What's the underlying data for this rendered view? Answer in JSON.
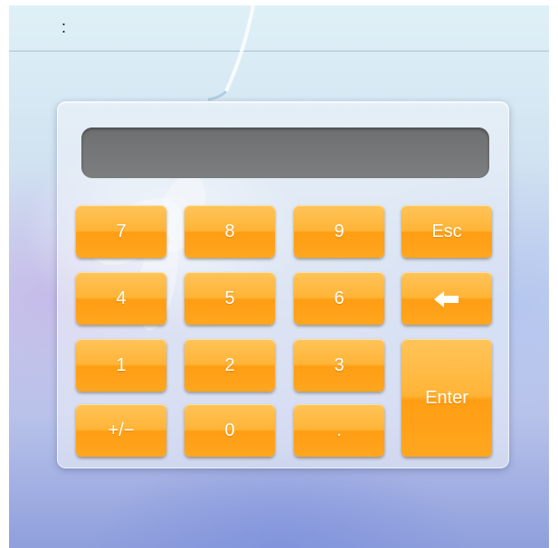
{
  "header": {
    "label": ":"
  },
  "display": {
    "value": ""
  },
  "keypad": {
    "k7": "7",
    "k8": "8",
    "k9": "9",
    "esc": "Esc",
    "k4": "4",
    "k5": "5",
    "k6": "6",
    "backspace_icon": "arrow-left-icon",
    "k1": "1",
    "k2": "2",
    "k3": "3",
    "enter": "Enter",
    "sign": "+/−",
    "k0": "0",
    "dot": "."
  },
  "colors": {
    "key_orange": "#ffb436",
    "display_gray": "#76787a"
  }
}
